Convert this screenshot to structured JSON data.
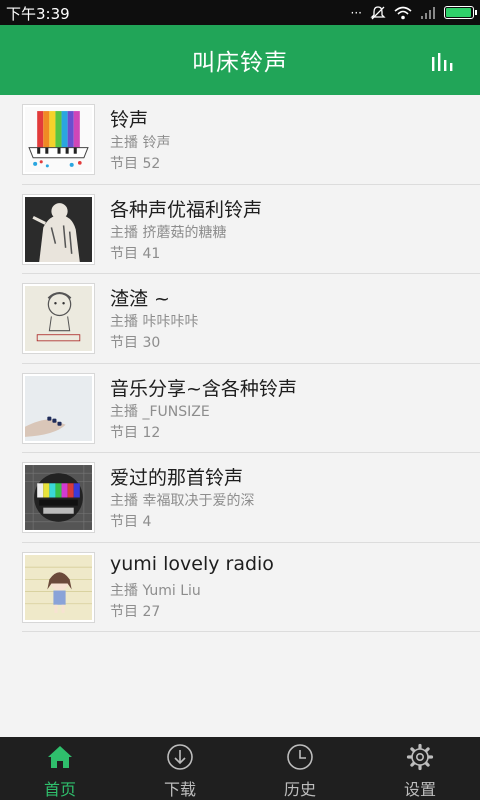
{
  "status_bar": {
    "time": "下午3:39",
    "icons": [
      "more-dots-icon",
      "mute-icon",
      "wifi-icon",
      "signal-icon",
      "battery-icon"
    ],
    "battery_level": 0.95,
    "battery_color": "#2fd16a"
  },
  "app_bar": {
    "title": "叫床铃声",
    "background": "#21a558",
    "menu_icon": "equalizer-icon"
  },
  "channels": [
    {
      "title": "铃声",
      "host": "主播 铃声",
      "count": "节目 52",
      "thumb_icon": "piano-keys-art"
    },
    {
      "title": "各种声优福利铃声",
      "host": "主播 挤蘑菇的糖糖",
      "count": "节目 41",
      "thumb_icon": "anime-character-art"
    },
    {
      "title": "渣渣 ~",
      "host": "主播 咔咔咔咔",
      "count": "节目 30",
      "thumb_icon": "cartoon-sketch-art"
    },
    {
      "title": "音乐分享~含各种铃声",
      "host": "主播 _FUNSIZE",
      "count": "节目 12",
      "thumb_icon": "hand-photo-art"
    },
    {
      "title": "爱过的那首铃声",
      "host": "主播 幸福取决于爱的深",
      "count": "节目 4",
      "thumb_icon": "tv-test-pattern-art"
    },
    {
      "title": "yumi lovely radio",
      "host": "主播 Yumi Liu",
      "count": "节目 27",
      "thumb_icon": "anime-girl-art"
    }
  ],
  "tabs": [
    {
      "label": "首页",
      "icon": "home-icon",
      "active": true
    },
    {
      "label": "下载",
      "icon": "download-icon",
      "active": false
    },
    {
      "label": "历史",
      "icon": "clock-icon",
      "active": false
    },
    {
      "label": "设置",
      "icon": "gear-icon",
      "active": false
    }
  ],
  "colors": {
    "accent": "#2fbf6c",
    "tab_bar": "#1f1f1f"
  }
}
